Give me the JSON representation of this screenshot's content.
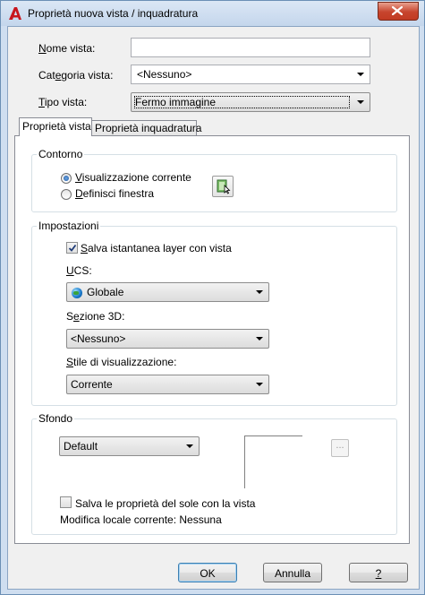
{
  "window": {
    "title": "Proprietà nuova vista / inquadratura",
    "accent": "#6b8fb5",
    "close_color": "#c7442d"
  },
  "form": {
    "name_label_u": "N",
    "name_label_rest": "ome vista:",
    "name_value": "",
    "category_label_pre": "Cat",
    "category_label_u": "e",
    "category_label_rest": "goria vista:",
    "category_value": "<Nessuno>",
    "type_label_u": "T",
    "type_label_rest": "ipo vista:",
    "type_value": "Fermo immagine"
  },
  "tabs": [
    {
      "label": "Proprietà vista",
      "active": true
    },
    {
      "label": "Proprietà inquadratura",
      "active": false
    }
  ],
  "contorno": {
    "title": "Contorno",
    "radio1_u": "V",
    "radio1_rest": "isualizzazione corrente",
    "radio1_checked": true,
    "radio2_u": "D",
    "radio2_rest": "efinisci finestra",
    "radio2_checked": false,
    "define_window_icon": "define-window-icon"
  },
  "impostazioni": {
    "title": "Impostazioni",
    "save_layer_u": "S",
    "save_layer_rest": "alva istantanea layer con vista",
    "save_layer_checked": true,
    "ucs_label_u": "U",
    "ucs_label_rest": "CS:",
    "ucs_value": "Globale",
    "ucs_icon": "globe-icon",
    "section_label_pre": "S",
    "section_label_u": "e",
    "section_label_rest": "zione 3D:",
    "section_value": "<Nessuno>",
    "style_label_u": "S",
    "style_label_rest": "tile di visualizzazione:",
    "style_value": "Corrente"
  },
  "sfondo": {
    "title": "Sfondo",
    "bg_value": "Default",
    "browse_label": "...",
    "sun_label": "Salva le proprietà del sole con la vista",
    "sun_checked": false,
    "override_label": "Modifica locale corrente: Nessuna"
  },
  "buttons": {
    "ok": "OK",
    "cancel": "Annulla",
    "help": "?"
  }
}
